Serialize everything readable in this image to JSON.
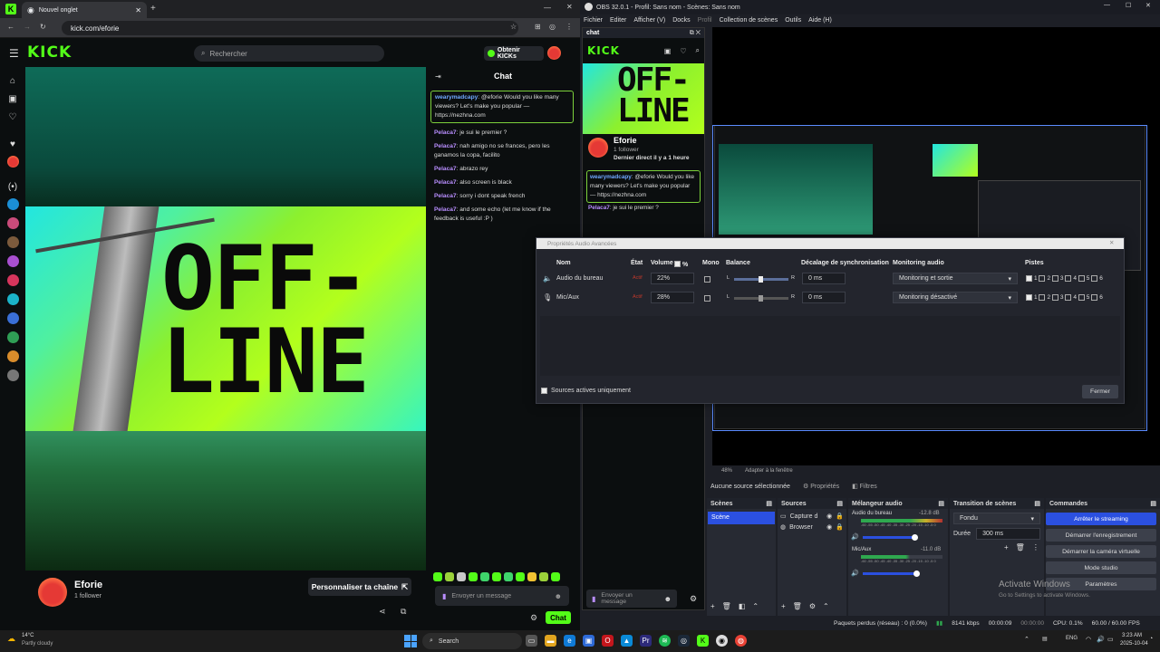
{
  "browser": {
    "tab_title": "Nouvel onglet",
    "url": "kick.com/eforie",
    "logo": "KICK",
    "search_placeholder": "Rechercher",
    "get_kicks": "Obtenir KICKs",
    "chat_title": "Chat",
    "offline_text_1": "OFF-",
    "offline_text_2": "LINE",
    "channel_name": "Eforie",
    "followers": "1 follower",
    "customize": "Personnaliser ta chaîne",
    "chat_placeholder": "Envoyer un message",
    "chat_button": "Chat",
    "messages": [
      {
        "user": "wearymadcapy",
        "text": ": @eforie Would you like many viewers? Let's make you popular — https://nezhna.com"
      },
      {
        "user": "Pelaca7",
        "text": ": je sui le premier ?"
      },
      {
        "user": "Pelaca7",
        "text": ": nah amigo no se frances, pero les ganamos la copa, facilito"
      },
      {
        "user": "Pelaca7",
        "text": ": abrazo rey"
      },
      {
        "user": "Pelaca7",
        "text": ": also screen is black"
      },
      {
        "user": "Pelaca7",
        "text": ": sorry i dont speak french"
      },
      {
        "user": "Pelaca7",
        "text": ": and some echo (let me know if the feedback is useful :P )"
      }
    ]
  },
  "obs": {
    "title": "OBS 32.0.1 - Profil: Sans nom - Scènes: Sans nom",
    "menu": [
      "Fichier",
      "Editer",
      "Afficher (V)",
      "Docks",
      "Profil",
      "Collection de scènes",
      "Outils",
      "Aide (H)"
    ],
    "dock_title": "chat",
    "dock_channel": "Eforie",
    "dock_followers": "1 follower",
    "dock_last_live": "Dernier direct il y a 1 heure",
    "dock_msg_user": "wearymadcapy",
    "dock_msg_text": ": @eforie Would you like many viewers? Let's make you popular — https://nezhna.com",
    "dock_msg2_user": "Pelaca7",
    "dock_msg2_text": ": je sui le premier ?",
    "dock_placeholder": "Envoyer un message",
    "zoom": "48%",
    "fit": "Adapter à la fenêtre",
    "no_source": "Aucune source sélectionnée",
    "properties": "Propriétés",
    "filters": "Filtres",
    "scenes_title": "Scènes",
    "scene_item": "Scène",
    "sources_title": "Sources",
    "sources": [
      "Capture d",
      "Browser"
    ],
    "mixer_title": "Mélangeur audio",
    "mixer": [
      {
        "name": "Audio du bureau",
        "db": "-12.8 dB"
      },
      {
        "name": "Mic/Aux",
        "db": "-11.0 dB"
      }
    ],
    "mixer_scale": "-60 -55 -50 -45 -40 -35 -30 -25 -20 -15 -10 -5 0",
    "transitions_title": "Transition de scènes",
    "transition": "Fondu",
    "duration_label": "Durée",
    "duration": "300 ms",
    "commands_title": "Commandes",
    "commands": [
      "Arrêter le streaming",
      "Démarrer l'enregistrement",
      "Démarrer la caméra virtuelle",
      "Mode studio",
      "Paramètres"
    ],
    "activate_1": "Activate Windows",
    "activate_2": "Go to Settings to activate Windows.",
    "status": {
      "dropped": "Paquets perdus (réseau) : 0 (0.0%)",
      "bitrate": "8141 kbps",
      "live_time": "00:00:09",
      "rec_time": "00:00:00",
      "cpu": "CPU: 0.1%",
      "fps": "60.00 / 60.00 FPS"
    }
  },
  "dialog": {
    "title": "Propriétés Audio Avancées",
    "headers": {
      "name": "Nom",
      "state": "État",
      "volume": "Volume",
      "percent": "%",
      "mono": "Mono",
      "balance": "Balance",
      "sync": "Décalage de synchronisation",
      "monitoring": "Monitoring audio",
      "tracks": "Pistes"
    },
    "rows": [
      {
        "name": "Audio du bureau",
        "state": "Actif",
        "volume": "22%",
        "sync": "0 ms",
        "monitoring": "Monitoring et sortie"
      },
      {
        "name": "Mic/Aux",
        "state": "Actif",
        "volume": "28%",
        "sync": "0 ms",
        "monitoring": "Monitoring désactivé"
      }
    ],
    "balance_l": "L",
    "balance_r": "R",
    "track_nums": [
      "1",
      "2",
      "3",
      "4",
      "5",
      "6"
    ],
    "active_only": "Sources actives uniquement",
    "close": "Fermer"
  },
  "taskbar": {
    "weather_temp": "14°C",
    "weather_desc": "Partly cloudy",
    "search": "Search",
    "lang": "ENG",
    "time": "3:23 AM",
    "date": "2025-10-04"
  },
  "colors": {
    "kick_green": "#53fc18",
    "obs_accent": "#2b50e0",
    "username": "#b98eff"
  }
}
